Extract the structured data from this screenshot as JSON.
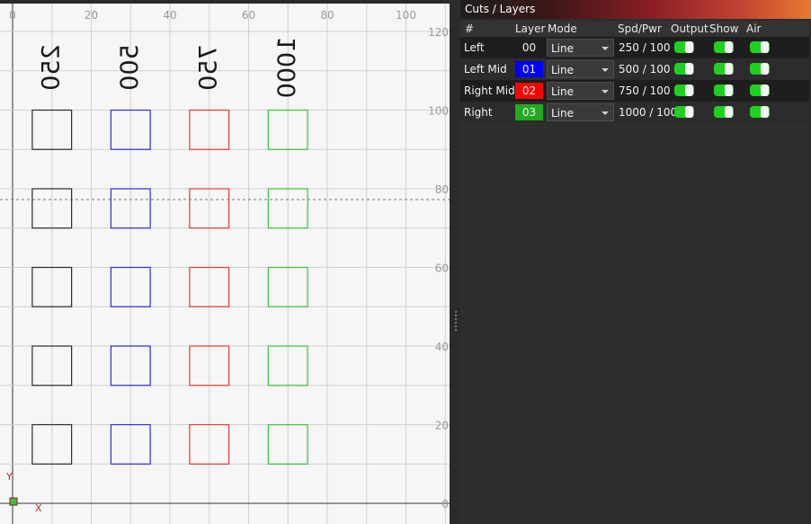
{
  "canvas": {
    "top_ruler": [
      "0",
      "20",
      "40",
      "60",
      "80",
      "100"
    ],
    "right_ruler": [
      "120",
      "100",
      "80",
      "60",
      "40",
      "20",
      "0"
    ],
    "axis_y": "Y",
    "axis_x": "X",
    "column_labels": [
      "250",
      "500",
      "750",
      "1000"
    ],
    "column_colors": [
      "#2a2a2a",
      "#2c2cd4",
      "#e23a3a",
      "#35c435"
    ]
  },
  "panel": {
    "title": "Cuts / Layers",
    "headers": {
      "num": "#",
      "layer": "Layer",
      "mode": "Mode",
      "spd_pwr": "Spd/Pwr",
      "output": "Output",
      "show": "Show",
      "air": "Air"
    },
    "rows": [
      {
        "name": "Left",
        "layer": "00",
        "layer_color": "#1e1e1e",
        "mode": "Line",
        "spd_pwr": "250 / 100",
        "output": true,
        "show": true,
        "air": true
      },
      {
        "name": "Left Mid",
        "layer": "01",
        "layer_color": "#0000ff",
        "mode": "Line",
        "spd_pwr": "500 / 100",
        "output": true,
        "show": true,
        "air": true
      },
      {
        "name": "Right Mid",
        "layer": "02",
        "layer_color": "#ff0000",
        "mode": "Line",
        "spd_pwr": "750 / 100",
        "output": true,
        "show": true,
        "air": true
      },
      {
        "name": "Right",
        "layer": "03",
        "layer_color": "#22aa22",
        "mode": "Line",
        "spd_pwr": "1000 / 100",
        "output": true,
        "show": true,
        "air": true
      }
    ],
    "toggle_color": "#1fd11f"
  }
}
